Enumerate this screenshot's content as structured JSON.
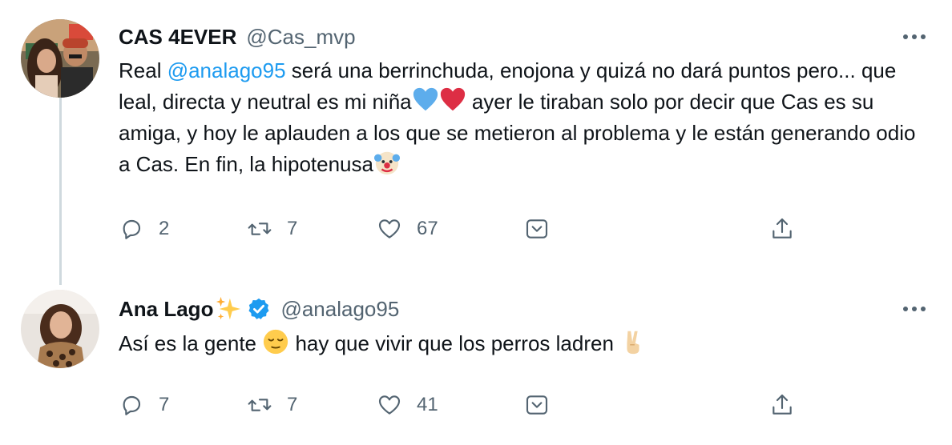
{
  "tweets": [
    {
      "author_name": "CAS 4EVER",
      "handle": "@Cas_mvp",
      "text_1": "Real ",
      "mention": "@analago95",
      "text_2": " será una berrinchuda, enojona y quizá no dará puntos pero... que leal, directa y neutral es mi niña",
      "text_3": " ayer le tiraban solo por decir que Cas es su amiga, y hoy le aplauden a los que se metieron al problema y le están generando odio a Cas. En fin, la hipotenusa",
      "replies": "2",
      "retweets": "7",
      "likes": "67"
    },
    {
      "author_name": "Ana Lago",
      "handle": "@analago95",
      "text_1": "Así es la gente ",
      "text_2": " hay que vivir que los perros ladren ",
      "replies": "7",
      "retweets": "7",
      "likes": "41"
    }
  ],
  "colors": {
    "accent": "#1d9bf0",
    "text": "#0f1419",
    "secondary": "#536471",
    "thread_line": "#cfd9de"
  },
  "icons": [
    "reply-icon",
    "retweet-icon",
    "like-icon",
    "bookmark-icon",
    "share-icon",
    "more-icon",
    "verified-icon"
  ]
}
